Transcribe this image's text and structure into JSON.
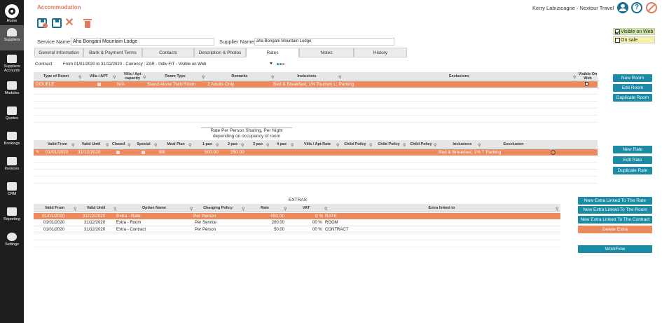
{
  "sidebar": {
    "items": [
      {
        "label": "Home"
      },
      {
        "label": "Suppliers"
      },
      {
        "label": "Suppliers Accounts"
      },
      {
        "label": "Modules"
      },
      {
        "label": "Quotes"
      },
      {
        "label": "Bookings"
      },
      {
        "label": "Invoices"
      },
      {
        "label": "CRM"
      },
      {
        "label": "Reporting"
      },
      {
        "label": "Settings"
      }
    ]
  },
  "header": {
    "title": "Accommodation",
    "user": "Kerry Labuscagne - Nextour Travel",
    "help_glyph": "?"
  },
  "toolbar": {
    "close_glyph": "✕"
  },
  "visibility": {
    "visible_on_web": "Visible on Web",
    "on_sale": "On sale"
  },
  "form": {
    "service_label": "Service Name",
    "service_value": "Aha Bongani Mountain Lodge",
    "supplier_label": "Supplier Name",
    "supplier_value": "aha Bongani Mountain Lodge"
  },
  "tabs": [
    "General Information",
    "Bank & Payment Terms",
    "Contacts",
    "Description & Photos",
    "Rates",
    "Notes",
    "History"
  ],
  "contract": {
    "label": "Contract",
    "value": "From 01/01/2020 to 31/12/2020 - Currency : ZAR - Indiv FIT - Visible on Web"
  },
  "rooms": {
    "headers": [
      "Type of Room",
      "Villa / APT",
      "Villa / Apt capacity",
      "Room Type",
      "Remarks",
      "Inclusions",
      "Exclusions",
      "Visible On Web"
    ],
    "rows": [
      {
        "type": "DOUBLE",
        "villa": "",
        "capacity": "N/A",
        "room_type": "Stand Alone Twin Room",
        "remarks": "2 Adults Only",
        "inclusions": "Bed & Breakfast; 1% Tourism L; Parking",
        "exclusions": ""
      }
    ],
    "buttons": {
      "new": "New Room",
      "edit": "Edit Room",
      "duplicate": "Duplicate Room"
    }
  },
  "rates": {
    "title1": "Rate Per Person Sharing, Per Night",
    "title2": "depending on occupancy of room",
    "headers": [
      "Valid From",
      "Valid Until",
      "Closed",
      "Special",
      "Meal Plan",
      "1 pax",
      "2 pax",
      "3 pax",
      "4 pax",
      "Villa / Apt Rate",
      "Child Policy",
      "Child Policy",
      "Child Policy",
      "Inclusions",
      "Excclusion"
    ],
    "rows": [
      {
        "from": "01/01/2020",
        "until": "31/12/2020",
        "meal": "BB",
        "pax1": "500.00",
        "pax2": "250.00",
        "inclusions": "Bed & Breakfast; 1% T Parking"
      }
    ],
    "buttons": {
      "new": "New Rate",
      "edit": "Edit Rate",
      "duplicate": "Duplicate Rate"
    }
  },
  "extras": {
    "title": "EXTRAS",
    "headers": [
      "Valid From",
      "Valid Until",
      "Option Name",
      "Charging Policy",
      "Rate",
      "VAT",
      "Extra linked to"
    ],
    "rows": [
      {
        "from": "01/01/2020",
        "until": "31/12/2020",
        "option": "Extra - Rate",
        "policy": "Per Person",
        "rate": "150.00",
        "vat": "0 %",
        "linked": "RATE"
      },
      {
        "from": "01/01/2020",
        "until": "31/12/2020",
        "option": "Extra - Room",
        "policy": "Per Service",
        "rate": "200.00",
        "vat": "00 %",
        "linked": "ROOM"
      },
      {
        "from": "01/01/2020",
        "until": "31/12/2020",
        "option": "Extra - Contract",
        "policy": "Per Person",
        "rate": "50.00",
        "vat": "00 %",
        "linked": "CONTRACT"
      }
    ],
    "buttons": {
      "rate": "New Extra Linked To The Rate",
      "room": "New Extra Linked To The Room",
      "contract": "New Extra Linked To The Contract",
      "delete": "Delete Extra",
      "workflow": "WorkFlow"
    }
  },
  "colors": {
    "accent": "#e07a5f",
    "selected_row": "#ec8a5f",
    "button": "#1a8aa5",
    "dark": "#1e1e1e"
  }
}
